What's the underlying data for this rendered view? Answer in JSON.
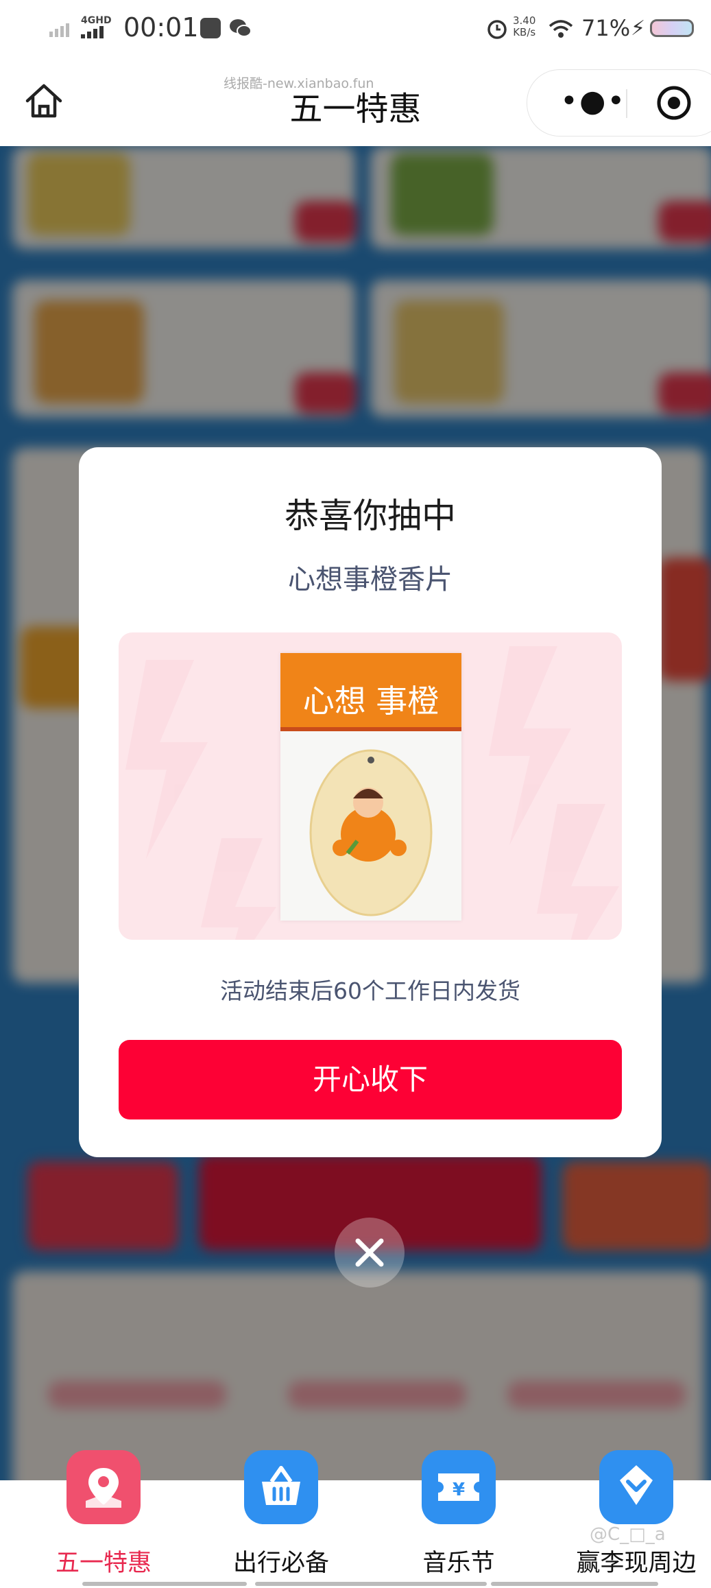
{
  "status_bar": {
    "network": "4GHD",
    "time": "00:01",
    "net_speed_value": "3.40",
    "net_speed_unit": "KB/s",
    "battery": "71%"
  },
  "nav": {
    "watermark": "线报酷-new.xianbao.fun",
    "title": "五一特惠"
  },
  "modal": {
    "title": "恭喜你抽中",
    "prize_name": "心想事橙香片",
    "product_brand_text": "心想 事橙",
    "shipping_note": "活动结束后60个工作日内发货",
    "confirm_label": "开心收下"
  },
  "tabs": [
    {
      "label": "五一特惠",
      "icon": "map-pin-icon",
      "color": "#f0506e",
      "active": true
    },
    {
      "label": "出行必备",
      "icon": "basket-icon",
      "color": "#2f90f0",
      "active": false
    },
    {
      "label": "音乐节",
      "icon": "ticket-icon",
      "color": "#2f90f0",
      "active": false
    },
    {
      "label": "赢李现周边",
      "icon": "diamond-icon",
      "color": "#2f90f0",
      "active": false
    }
  ],
  "corner_watermark": "@C_□_a",
  "colors": {
    "accent_red": "#fd0135",
    "tab_active": "#e8294f",
    "tab_icon_blue": "#2f90f0",
    "tab_icon_pink": "#f0506e",
    "prize_bg": "#fde6ea"
  }
}
